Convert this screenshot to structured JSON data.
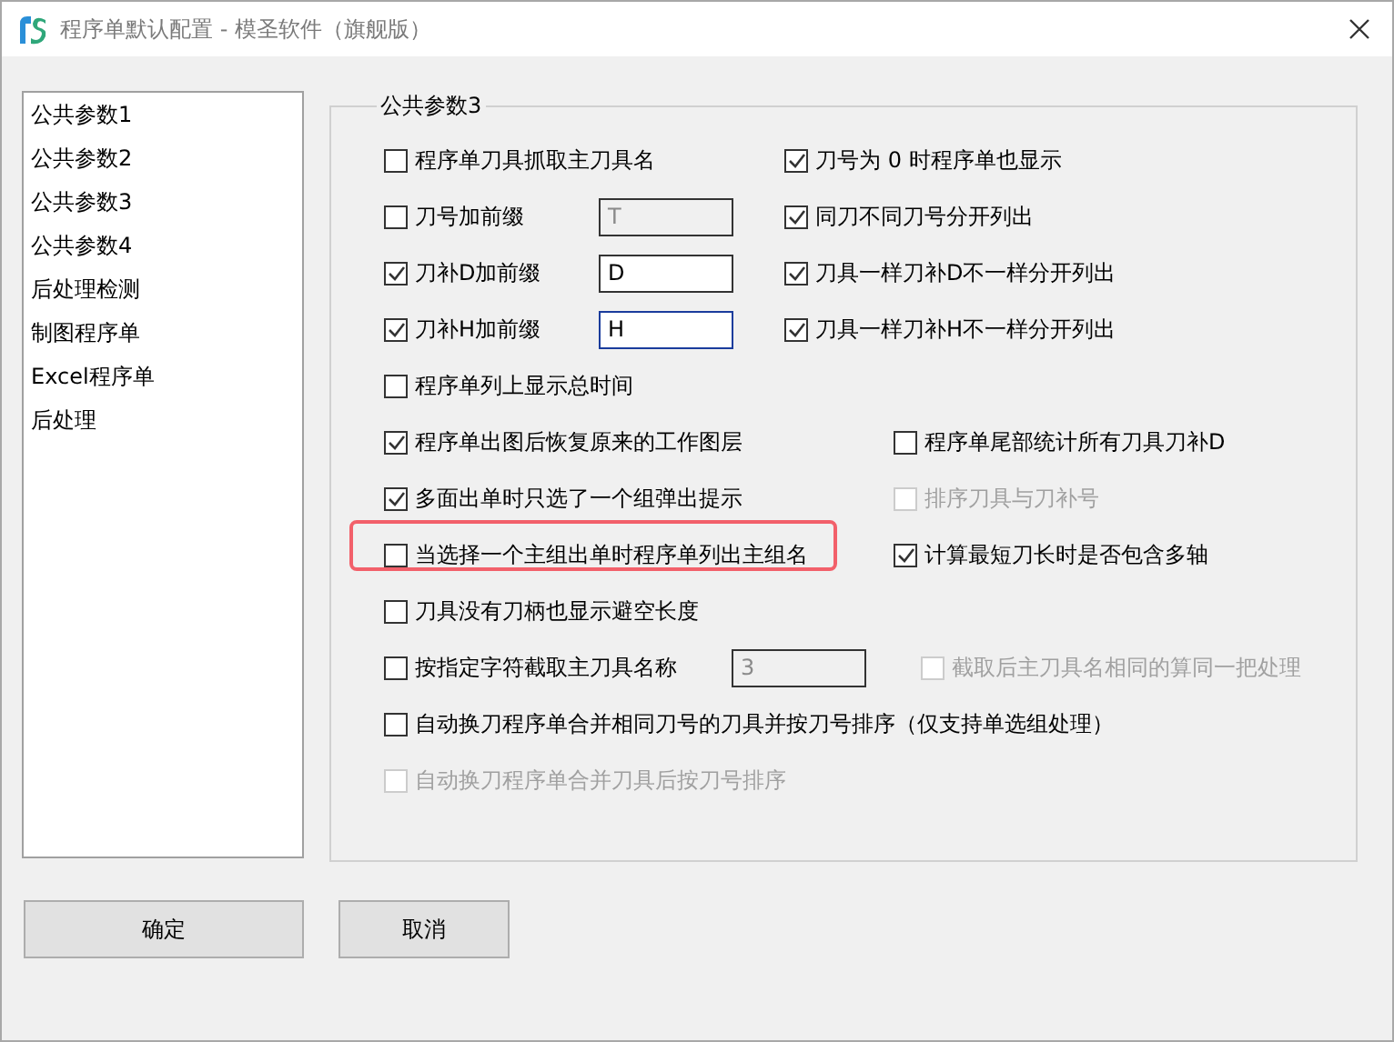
{
  "window": {
    "title": "程序单默认配置 - 模圣软件（旗舰版）"
  },
  "sidebar": {
    "items": [
      {
        "label": "公共参数1",
        "selected": false
      },
      {
        "label": "公共参数2",
        "selected": false
      },
      {
        "label": "公共参数3",
        "selected": false
      },
      {
        "label": "公共参数4",
        "selected": false
      },
      {
        "label": "后处理检测",
        "selected": false
      },
      {
        "label": "制图程序单",
        "selected": false
      },
      {
        "label": "Excel程序单",
        "selected": false
      },
      {
        "label": "后处理",
        "selected": false
      }
    ]
  },
  "group": {
    "title": "公共参数3",
    "rows": [
      {
        "kind": "pair",
        "left": {
          "label": "程序单刀具抓取主刀具名",
          "checked": false,
          "disabled": false
        },
        "right": {
          "label": "刀号为 0 时程序单也显示",
          "checked": true,
          "disabled": false
        }
      },
      {
        "kind": "pair",
        "left": {
          "label": "刀号加前缀",
          "checked": false,
          "disabled": false
        },
        "field": {
          "value": "T",
          "disabled": true,
          "focused": false
        },
        "right": {
          "label": "同刀不同刀号分开列出",
          "checked": true,
          "disabled": false
        }
      },
      {
        "kind": "pair",
        "left": {
          "label": "刀补D加前缀",
          "checked": true,
          "disabled": false
        },
        "field": {
          "value": "D",
          "disabled": false,
          "focused": false
        },
        "right": {
          "label": "刀具一样刀补D不一样分开列出",
          "checked": true,
          "disabled": false
        }
      },
      {
        "kind": "pair",
        "left": {
          "label": "刀补H加前缀",
          "checked": true,
          "disabled": false
        },
        "field": {
          "value": "H",
          "disabled": false,
          "focused": true
        },
        "right": {
          "label": "刀具一样刀补H不一样分开列出",
          "checked": true,
          "disabled": false
        }
      },
      {
        "kind": "single",
        "left": {
          "label": "程序单列上显示总时间",
          "checked": false,
          "disabled": false
        }
      },
      {
        "kind": "wide",
        "left": {
          "label": "程序单出图后恢复原来的工作图层",
          "checked": true,
          "disabled": false
        },
        "right": {
          "label": "程序单尾部统计所有刀具刀补D",
          "checked": false,
          "disabled": false
        }
      },
      {
        "kind": "wide",
        "left": {
          "label": "多面出单时只选了一个组弹出提示",
          "checked": true,
          "disabled": false
        },
        "right": {
          "label": "排序刀具与刀补号",
          "checked": false,
          "disabled": true
        }
      },
      {
        "kind": "wide",
        "left": {
          "label": "当选择一个主组出单时程序单列出主组名",
          "checked": false,
          "disabled": false,
          "highlighted": true
        },
        "right": {
          "label": "计算最短刀长时是否包含多轴",
          "checked": true,
          "disabled": false
        }
      },
      {
        "kind": "single",
        "left": {
          "label": "刀具没有刀柄也显示避空长度",
          "checked": false,
          "disabled": false
        }
      },
      {
        "kind": "trim",
        "left": {
          "label": "按指定字符截取主刀具名称",
          "checked": false,
          "disabled": false
        },
        "field": {
          "value": "3",
          "disabled": true,
          "focused": false
        },
        "right": {
          "label": "截取后主刀具名相同的算同一把处理",
          "checked": false,
          "disabled": true
        }
      },
      {
        "kind": "single",
        "left": {
          "label": "自动换刀程序单合并相同刀号的刀具并按刀号排序（仅支持单选组处理）",
          "checked": false,
          "disabled": false
        }
      },
      {
        "kind": "single",
        "left": {
          "label": "自动换刀程序单合并刀具后按刀号排序",
          "checked": false,
          "disabled": true
        }
      }
    ]
  },
  "buttons": [
    {
      "label": "确定"
    },
    {
      "label": "取消"
    }
  ]
}
